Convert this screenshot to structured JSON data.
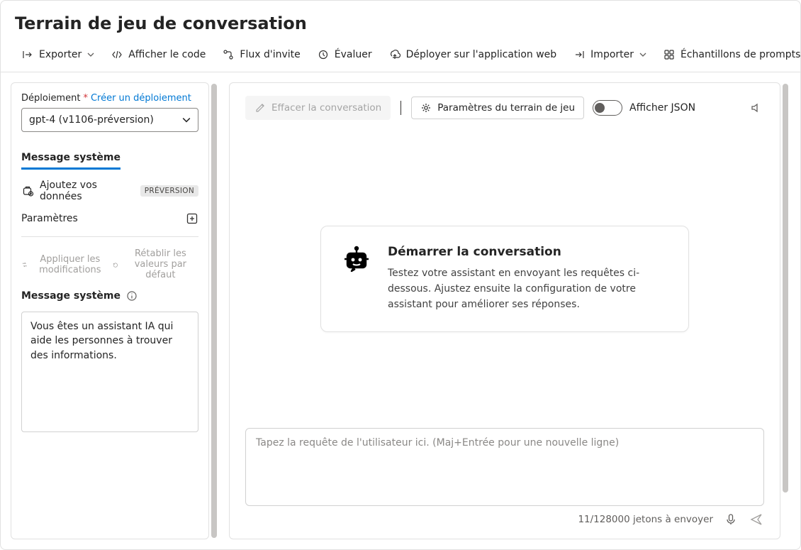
{
  "title": "Terrain de jeu de conversation",
  "toolbar": {
    "export": "Exporter",
    "show_code": "Afficher le code",
    "prompt_flow": "Flux d'invite",
    "evaluate": "Évaluer",
    "deploy_web": "Déployer sur l'application web",
    "import": "Importer",
    "samples": "Échantillons de prompts"
  },
  "left": {
    "deployment_label": "Déploiement",
    "create_deployment": "Créer un déploiement",
    "deployment_value": "gpt-4 (v1106-préversion)",
    "system_message_tab": "Message système",
    "add_data": "Ajoutez vos données",
    "preview_badge": "PRÉVERSION",
    "parameters_label": "Paramètres",
    "apply": "Appliquer les modifications",
    "reset": "Rétablir les valeurs par défaut",
    "system_message_label": "Message système",
    "system_message_value": "Vous êtes un assistant IA qui aide les personnes à trouver des informations."
  },
  "right": {
    "clear": "Effacer la conversation",
    "playground_settings": "Paramètres du terrain de jeu",
    "show_json": "Afficher JSON",
    "card_title": "Démarrer la conversation",
    "card_text": "Testez votre assistant en envoyant les requêtes ci-dessous. Ajustez ensuite la configuration de votre assistant pour améliorer ses réponses.",
    "input_placeholder": "Tapez la requête de l'utilisateur ici. (Maj+Entrée pour une nouvelle ligne)",
    "token_status": "11/128000 jetons à envoyer"
  }
}
